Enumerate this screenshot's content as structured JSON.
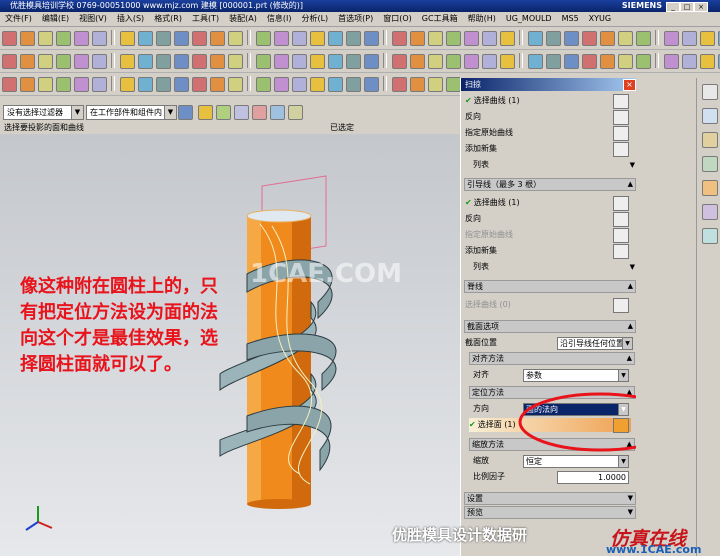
{
  "window": {
    "title_left": "NX 7.5",
    "title_text": "优胜模具培训学校   0769-00051000   www.mjz.com   建模   [000001.prt (修改的)]",
    "brand": "SIEMENS",
    "buttons": [
      "_",
      "□",
      "×"
    ]
  },
  "menu": [
    "文件(F)",
    "编辑(E)",
    "视图(V)",
    "插入(S)",
    "格式(R)",
    "工具(T)",
    "装配(A)",
    "信息(I)",
    "分析(L)",
    "首选项(P)",
    "窗口(O)",
    "GC工具箱",
    "帮助(H)",
    "UG_MOULD",
    "MS5",
    "XYUG"
  ],
  "selection_bar": {
    "filter": "没有选择过滤器",
    "scope": "在工作部件和组件内",
    "status_left": "选择要投影的面和曲线",
    "status_right": "已选定"
  },
  "viewport": {
    "annotation": "像这种附在圆柱上的，只有把定位方法设为面的法向这个才是最佳效果，选择圆柱面就可以了。",
    "watermark": "1CAE.COM"
  },
  "dialog": {
    "title": "扫掠",
    "rows": [
      {
        "label": "选择曲线 (1)",
        "check": true
      },
      {
        "label": "反向",
        "check": false
      },
      {
        "label": "指定原始曲线",
        "check": false
      },
      {
        "label": "添加新集",
        "check": false
      },
      {
        "label": "列表",
        "check": false
      }
    ],
    "section_guide": "引导线（最多 3 根）",
    "guide_rows": [
      {
        "label": "选择曲线 (1)",
        "check": true
      },
      {
        "label": "反向",
        "check": false
      },
      {
        "label": "指定原始曲线",
        "check": false,
        "dim": true
      },
      {
        "label": "添加新集",
        "check": false
      },
      {
        "label": "列表",
        "check": false
      }
    ],
    "section_spine": "脊线",
    "spine_row": "选择曲线 (0)",
    "section_options": "截面选项",
    "position_label": "截面位置",
    "position_value": "沿引导线任何位置",
    "alignment_header": "对齐方法",
    "alignment_label": "对齐",
    "alignment_value": "参数",
    "orientation_header": "定位方法",
    "orientation_label": "方向",
    "orientation_value": "面的法向",
    "select_face": "选择面 (1)",
    "scaling_header": "缩放方法",
    "scaling_label": "缩放",
    "scaling_value": "恒定",
    "factor_label": "比例因子",
    "factor_value": "1.0000",
    "settings": "设置",
    "preview": "预览"
  },
  "footer": {
    "watermark": "优胜模具设计数据研",
    "logo_cn": "仿真在线",
    "logo_url": "www.1CAE.com"
  },
  "colors": {
    "cylinder": "#f08a1c",
    "helix": "#8aa4aa",
    "highlight_ellipse": "#e8131b",
    "annotation": "#e8131b"
  }
}
